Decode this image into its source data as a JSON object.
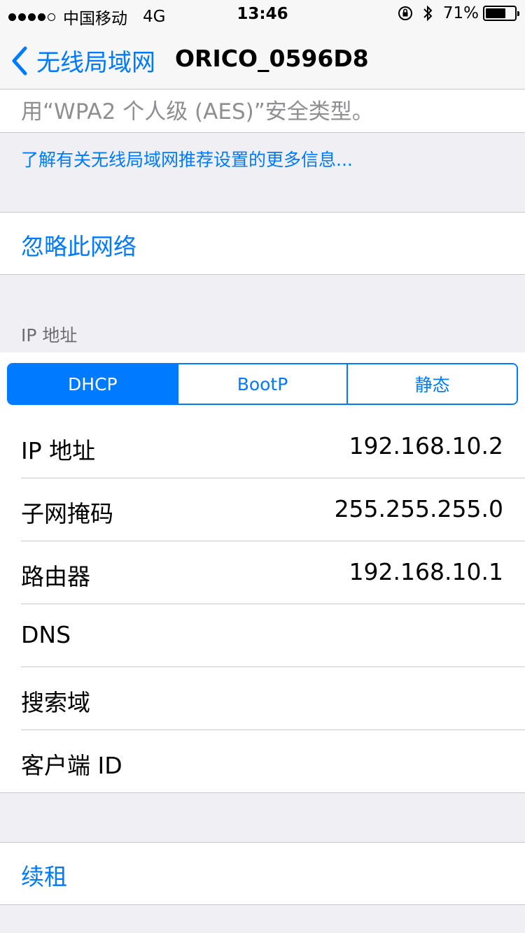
{
  "status_bar": {
    "carrier": "中国移动",
    "network": "4G",
    "time": "13:46",
    "battery_pct": "71%",
    "battery_level": 0.71,
    "signal_bars_filled": 4,
    "signal_bars_total": 5,
    "icons": [
      "orientation-lock-icon",
      "bluetooth-icon",
      "battery-icon"
    ]
  },
  "nav": {
    "back_label": "无线局域网",
    "title": "ORICO_0596D8"
  },
  "security_hint": "用“WPA2 个人级 (AES)”安全类型。",
  "info_link": "了解有关无线局域网推荐设置的更多信息...",
  "forget_network": "忽略此网络",
  "ip_section": {
    "header": "IP 地址",
    "segments": [
      "DHCP",
      "BootP",
      "静态"
    ],
    "selected": "DHCP",
    "rows": [
      {
        "label": "IP 地址",
        "value": "192.168.10.2"
      },
      {
        "label": "子网掩码",
        "value": "255.255.255.0"
      },
      {
        "label": "路由器",
        "value": "192.168.10.1"
      },
      {
        "label": "DNS",
        "value": ""
      },
      {
        "label": "搜索域",
        "value": ""
      },
      {
        "label": "客户端 ID",
        "value": ""
      }
    ]
  },
  "renew_lease": "续租",
  "colors": {
    "accent": "#007aff",
    "background": "#efeff4",
    "separator": "#c8c7cc"
  }
}
